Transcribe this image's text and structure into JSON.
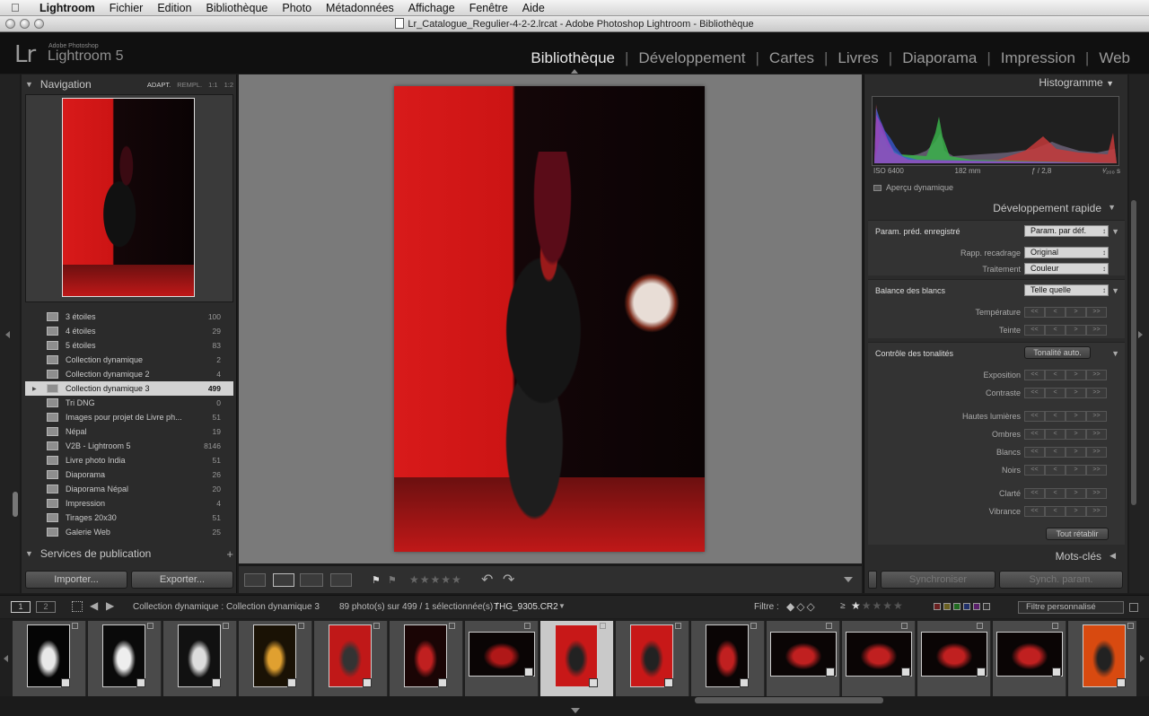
{
  "menubar": {
    "app": "Lightroom",
    "items": [
      "Fichier",
      "Edition",
      "Bibliothèque",
      "Photo",
      "Métadonnées",
      "Affichage",
      "Fenêtre",
      "Aide"
    ]
  },
  "window": {
    "title": "Lr_Catalogue_Regulier-4-2-2.lrcat - Adobe Photoshop Lightroom - Bibliothèque"
  },
  "identity": {
    "logo": "Lr",
    "brand_small": "Adobe Photoshop",
    "brand_big": "Lightroom 5"
  },
  "modules": [
    {
      "label": "Bibliothèque",
      "active": true
    },
    {
      "label": "Développement",
      "active": false
    },
    {
      "label": "Cartes",
      "active": false
    },
    {
      "label": "Livres",
      "active": false
    },
    {
      "label": "Diaporama",
      "active": false
    },
    {
      "label": "Impression",
      "active": false
    },
    {
      "label": "Web",
      "active": false
    }
  ],
  "navigator": {
    "title": "Navigation",
    "zoom": [
      "ADAPT.",
      "REMPL.",
      "1:1",
      "1:2"
    ]
  },
  "collections": [
    {
      "name": "3 étoiles",
      "count": "100",
      "selected": false
    },
    {
      "name": "4 étoiles",
      "count": "29",
      "selected": false
    },
    {
      "name": "5 étoiles",
      "count": "83",
      "selected": false
    },
    {
      "name": "Collection dynamique",
      "count": "2",
      "selected": false
    },
    {
      "name": "Collection dynamique  2",
      "count": "4",
      "selected": false
    },
    {
      "name": "Collection dynamique  3",
      "count": "499",
      "selected": true
    },
    {
      "name": "Tri DNG",
      "count": "0",
      "selected": false
    },
    {
      "name": "Images pour projet de Livre ph...",
      "count": "51",
      "selected": false
    },
    {
      "name": "Népal",
      "count": "19",
      "selected": false
    },
    {
      "name": "V2B - Lightroom 5",
      "count": "8146",
      "selected": false
    },
    {
      "name": "Livre photo India",
      "count": "51",
      "selected": false
    },
    {
      "name": "Diaporama",
      "count": "26",
      "selected": false
    },
    {
      "name": "Diaporama  Népal",
      "count": "20",
      "selected": false
    },
    {
      "name": "Impression",
      "count": "4",
      "selected": false
    },
    {
      "name": "Tirages 20x30",
      "count": "51",
      "selected": false
    },
    {
      "name": "Galerie Web",
      "count": "25",
      "selected": false
    }
  ],
  "publish": {
    "title": "Services de publication"
  },
  "left_buttons": {
    "import": "Importer...",
    "export": "Exporter..."
  },
  "histogram": {
    "title": "Histogramme",
    "iso": "ISO 6400",
    "focal": "182 mm",
    "aperture": "ƒ / 2,8",
    "shutter": "¹⁄₂₀₀ s",
    "preview": "Aperçu dynamique"
  },
  "quick_develop": {
    "title": "Développement rapide",
    "preset_label": "Param. préd. enregistré",
    "preset_value": "Param. par déf.",
    "crop_label": "Rapp. recadrage",
    "crop_value": "Original",
    "treatment_label": "Traitement",
    "treatment_value": "Couleur",
    "wb_label": "Balance des blancs",
    "wb_value": "Telle quelle",
    "temp_label": "Température",
    "tint_label": "Teinte",
    "tone_label": "Contrôle des tonalités",
    "auto_label": "Tonalité auto.",
    "exposure": "Exposition",
    "contrast": "Contraste",
    "highlights": "Hautes lumières",
    "shadows": "Ombres",
    "whites": "Blancs",
    "blacks": "Noirs",
    "clarity": "Clarté",
    "vibrance": "Vibrance",
    "reset": "Tout rétablir"
  },
  "keywords": {
    "title": "Mots-clés"
  },
  "sync": {
    "sync": "Synchroniser",
    "sync_params": "Synch. param."
  },
  "filmbar": {
    "page1": "1",
    "page2": "2",
    "source": "Collection dynamique : Collection dynamique  3",
    "info": "89 photo(s) sur 499 / 1 sélectionnée(s) /",
    "filename": "THG_9305.CR2",
    "filter_label": "Filtre :",
    "ge": "≥",
    "filter_value": "Filtre personnalisé"
  },
  "stepper_glyphs": {
    "ll": "<<",
    "l": "<",
    "r": ">",
    "rr": ">>"
  }
}
